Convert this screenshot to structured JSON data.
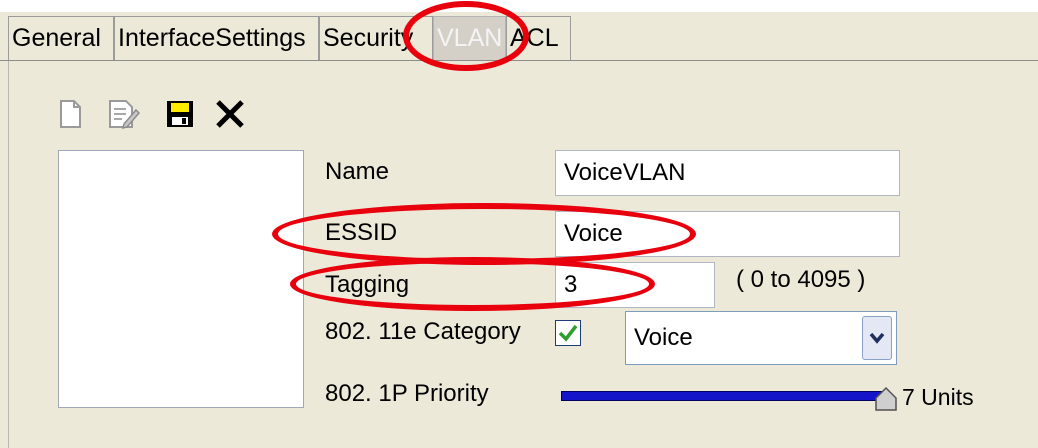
{
  "tabs": [
    {
      "label": "General"
    },
    {
      "label": "InterfaceSettings"
    },
    {
      "label": "Security"
    },
    {
      "label": "VLAN",
      "active": true
    },
    {
      "label": "ACL"
    }
  ],
  "toolbar": {
    "icons": [
      "new-document-icon",
      "edit-icon",
      "save-icon",
      "delete-icon"
    ]
  },
  "form": {
    "name_label": "Name",
    "name_value": "VoiceVLAN",
    "essid_label": "ESSID",
    "essid_value": "Voice",
    "tagging_label": "Tagging",
    "tagging_value": "3",
    "tagging_range": "( 0 to 4095 )",
    "category_label": "802. 11e Category",
    "category_checked": true,
    "category_value": "Voice",
    "priority_label": "802. 1P Priority",
    "priority_value": "7 Units",
    "priority_level": 1.0
  },
  "colors": {
    "highlight": "#e8000d",
    "slider": "#1414c8",
    "check": "#2e9e2e"
  }
}
